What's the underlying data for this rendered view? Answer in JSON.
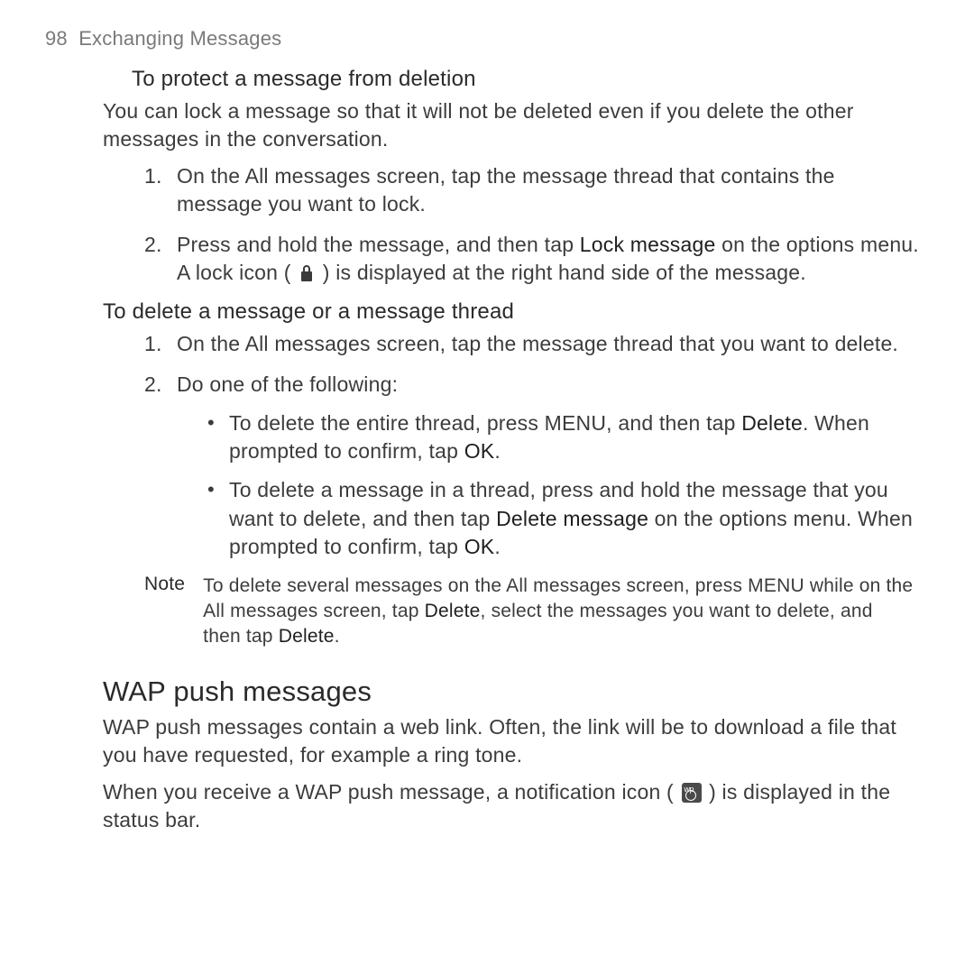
{
  "header": {
    "page_number": "98",
    "chapter": "Exchanging Messages"
  },
  "section1": {
    "title": "To protect a message from deletion",
    "intro": "You can lock a message so that it will not be deleted even if you delete the other messages in the conversation.",
    "steps": [
      {
        "num": "1.",
        "text": "On the All messages screen, tap the message thread that contains the message you want to lock."
      },
      {
        "num": "2.",
        "t1": "Press and hold the message, and then tap ",
        "b1": "Lock message",
        "t2": " on the options menu. A lock icon ( ",
        "t3": " ) is displayed at the right hand side of the message."
      }
    ]
  },
  "section2": {
    "title": "To delete a message or a message thread",
    "steps": [
      {
        "num": "1.",
        "text": "On the All messages screen, tap the message thread that you want to delete."
      },
      {
        "num": "2.",
        "text": "Do one of the following:",
        "bullets": [
          {
            "t1": "To delete the entire thread, press MENU, and then tap ",
            "b1": "Delete",
            "t2": ". When prompted to confirm, tap ",
            "b2": "OK",
            "t3": "."
          },
          {
            "t1": "To delete a message in a thread, press and hold the message that you want to delete, and then tap ",
            "b1": "Delete message",
            "t2": " on the options menu. When prompted to confirm, tap ",
            "b2": "OK",
            "t3": "."
          }
        ]
      }
    ]
  },
  "note": {
    "label": "Note",
    "t1": "To delete several messages on the All messages screen, press MENU while on the All messages screen, tap ",
    "b1": "Delete",
    "t2": ", select the messages you want to delete, and then tap ",
    "b2": "Delete",
    "t3": "."
  },
  "wap": {
    "heading": "WAP push messages",
    "p1": "WAP push messages contain a web link. Often, the link will be to download a file that you have requested, for example a ring tone.",
    "p2a": "When you receive a WAP push message, a notification icon ( ",
    "p2b": " ) is displayed in the status bar."
  }
}
